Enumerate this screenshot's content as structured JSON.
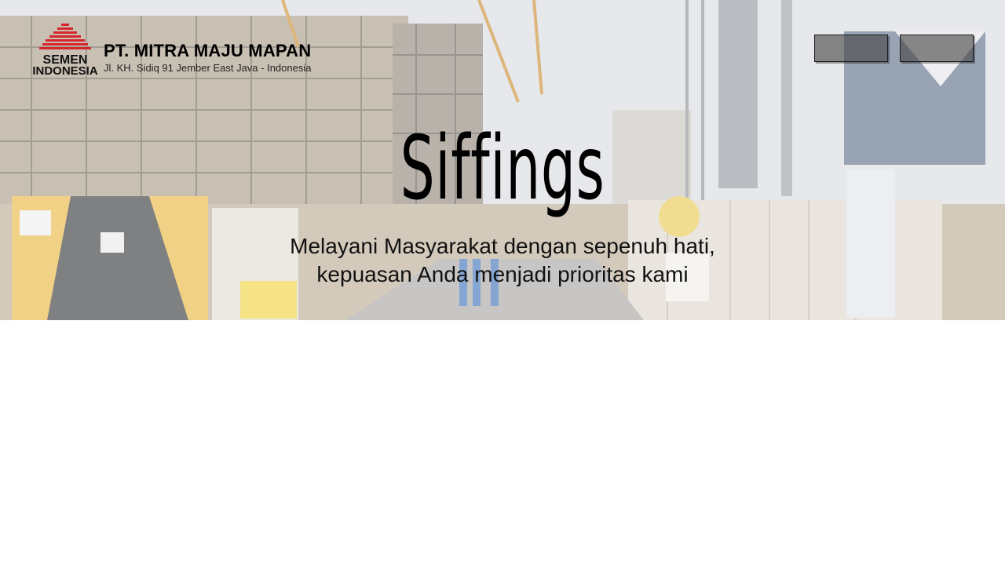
{
  "header": {
    "logo_text_top": "SEMEN",
    "logo_text_bottom": "INDONESIA",
    "company_name": "PT. MITRA MAJU MAPAN",
    "address": "Jl. KH. Sidiq 91 Jember East Java - Indonesia"
  },
  "nav": {
    "buttons": [
      "",
      ""
    ]
  },
  "hero": {
    "title": "Siffings",
    "subtitle_line1": "Melayani Masyarakat dengan sepenuh hati,",
    "subtitle_line2": "kepuasan Anda menjadi prioritas kami"
  },
  "colors": {
    "logo_red": "#d7262b",
    "logo_black": "#111111",
    "button_fill": "#464646"
  }
}
